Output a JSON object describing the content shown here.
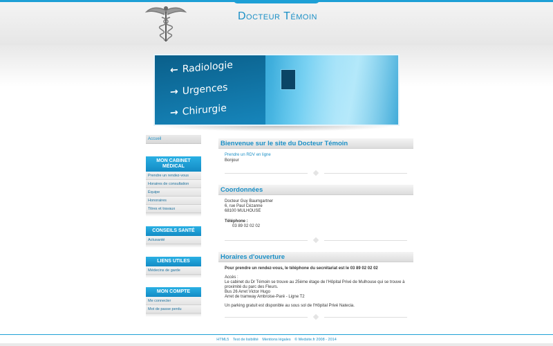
{
  "header": {
    "title": "Docteur Témoin",
    "logo_icon": "caduceus-icon"
  },
  "banner": {
    "signs": [
      "Radiologie",
      "Urgences",
      "Chirurgie"
    ],
    "arrows": [
      "←",
      "→",
      "→"
    ]
  },
  "nav": {
    "home": "Accueil"
  },
  "sidebar": {
    "cabinet": {
      "title": "MON CABINET MÉDICAL",
      "items": [
        "Prendre un rendez-vous",
        "Horaires de consultation",
        "Équipe",
        "Honoraires",
        "Titres et travaux"
      ]
    },
    "conseils": {
      "title": "CONSEILS SANTÉ",
      "items": [
        "Actusanté"
      ]
    },
    "liens": {
      "title": "LIENS UTILES",
      "items": [
        "Médecins de garde"
      ]
    },
    "compte": {
      "title": "MON COMPTE",
      "items": [
        "Me connecter",
        "Mot de passe perdu"
      ]
    }
  },
  "welcome": {
    "title": "Bienvenue sur le site du Docteur Témoin",
    "link": "Prendre un RDV en ligne",
    "text": "Bonjour"
  },
  "coords": {
    "title": "Coordonnées",
    "name": "Docteur Guy Baumgartner",
    "street": "6, rue Paul Cézanne",
    "city": "68100 MULHOUSE",
    "phone_label": "Téléphone :",
    "phone": "03 89 02 02 02"
  },
  "hours": {
    "title": "Horaires d'ouverture",
    "intro": "Pour prendre un rendez-vous, le téléphone du secrétariat est le 03 89 02 02 02",
    "access_label": "Accès :",
    "access_1": "Le cabinet du Dr Témoin se trouve au 25ème étage de l'Hôpital Privé de Mulhouse qui se trouve à proximité du parc des Fleurs.",
    "access_2": "Bus 26 Arret Victor Hugo",
    "access_3": "Arret de tramway Ambroise-Paré - Ligne T2",
    "parking": "Un parking gratuit est disponible au sous sol de l'Hôpital Privé Natecia."
  },
  "footer": {
    "items": [
      "HTML5",
      "Test de lisibilité",
      "Mentions légales",
      "© Medsite.fr 2008 - 2014"
    ]
  },
  "colors": {
    "accent": "#1a8fc6",
    "bar": "#1ea0d6"
  }
}
